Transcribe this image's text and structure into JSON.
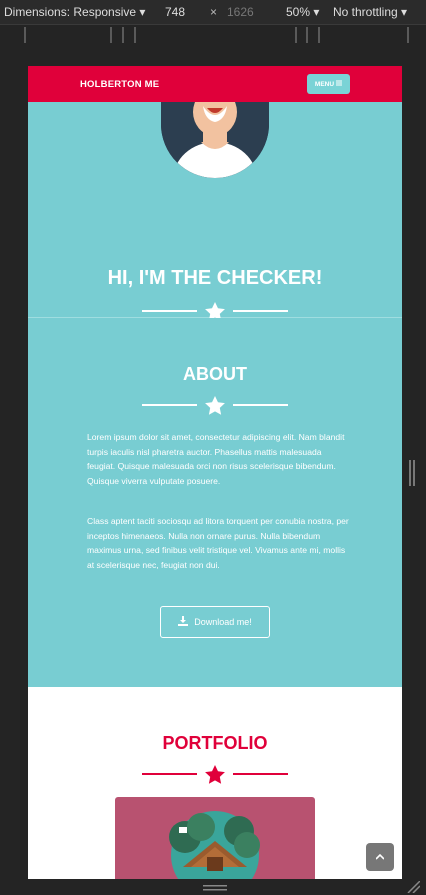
{
  "devtools": {
    "dimensions_label": "Dimensions: Responsive",
    "width_value": "748",
    "times": "×",
    "height_value": "1626",
    "zoom": "50%",
    "throttling": "No throttling"
  },
  "nav": {
    "brand": "HOLBERTON ME",
    "menu_label": "MENU"
  },
  "hero": {
    "title": "HI, I'M THE CHECKER!"
  },
  "about": {
    "title": "ABOUT",
    "para1": "Lorem ipsum dolor sit amet, consectetur adipiscing elit. Nam blandit turpis iaculis nisl pharetra auctor. Phasellus mattis malesuada feugiat. Quisque malesuada orci non risus scelerisque bibendum. Quisque viverra vulputate posuere.",
    "para2": "Class aptent taciti sociosqu ad litora torquent per conubia nostra, per inceptos himenaeos. Nulla non ornare purus. Nulla bibendum maximus urna, sed finibus velit tristique vel. Vivamus ante mi, mollis at scelerisque nec, feugiat non dui.",
    "download_label": "Download me!"
  },
  "portfolio": {
    "title": "PORTFOLIO"
  },
  "colors": {
    "brand_red": "#e0003a",
    "teal": "#78cdd2",
    "card": "#b85270"
  }
}
